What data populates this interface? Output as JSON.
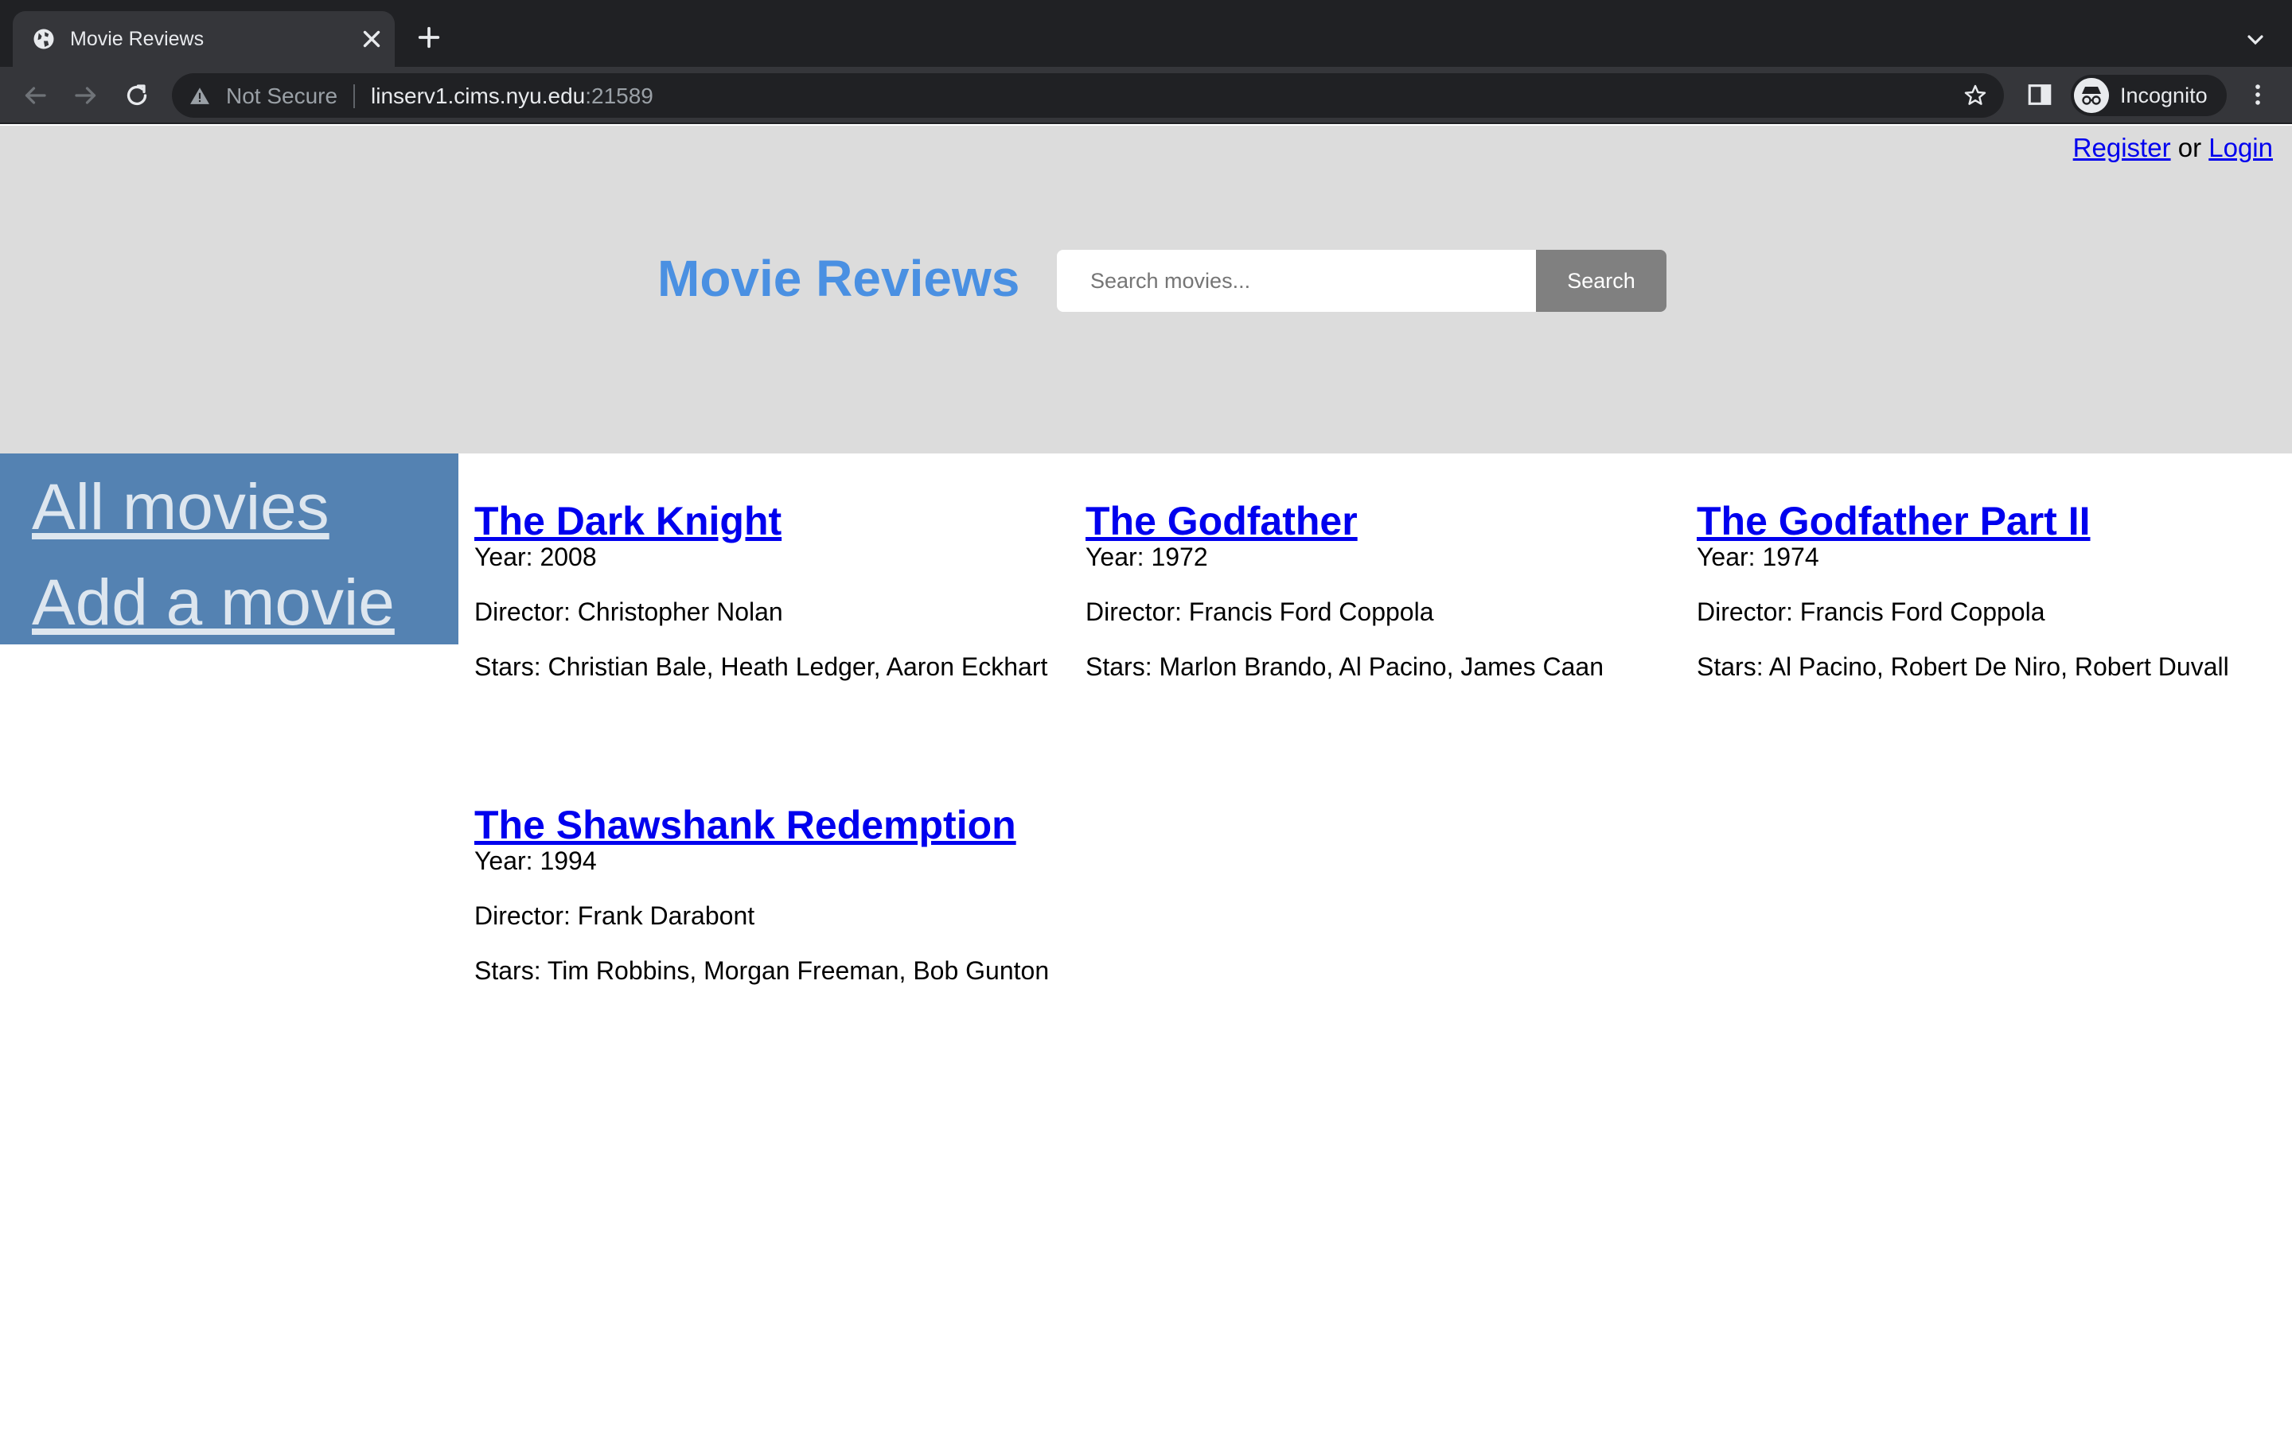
{
  "browser": {
    "tab_title": "Movie Reviews",
    "security_label": "Not Secure",
    "url_host": "linserv1.cims.nyu.edu",
    "url_port": ":21589",
    "profile_label": "Incognito"
  },
  "header": {
    "register_label": "Register",
    "or_text": "or",
    "login_label": "Login",
    "site_title": "Movie Reviews",
    "search_placeholder": "Search movies...",
    "search_button": "Search"
  },
  "sidebar": {
    "items": [
      {
        "label": "All movies"
      },
      {
        "label": "Add a movie"
      }
    ]
  },
  "movies": [
    {
      "title": "The Dark Knight",
      "year": "Year: 2008",
      "director": "Director: Christopher Nolan",
      "stars": "Stars: Christian Bale, Heath Ledger, Aaron Eckhart"
    },
    {
      "title": "The Godfather",
      "year": "Year: 1972",
      "director": "Director: Francis Ford Coppola",
      "stars": "Stars: Marlon Brando, Al Pacino, James Caan"
    },
    {
      "title": "The Godfather Part II",
      "year": "Year: 1974",
      "director": "Director: Francis Ford Coppola",
      "stars": "Stars: Al Pacino, Robert De Niro, Robert Duvall"
    },
    {
      "title": "The Shawshank Redemption",
      "year": "Year: 1994",
      "director": "Director: Frank Darabont",
      "stars": "Stars: Tim Robbins, Morgan Freeman, Bob Gunton"
    }
  ],
  "icons": {
    "tab_favicon": "globe-icon",
    "tab_close": "close-icon",
    "new_tab": "plus-icon",
    "back": "back-arrow-icon",
    "forward": "forward-arrow-icon",
    "reload": "reload-icon",
    "warning": "warning-icon",
    "bookmark": "star-icon",
    "side_panel": "side-panel-icon",
    "incognito": "incognito-icon",
    "menu": "kebab-menu-icon"
  },
  "colors": {
    "site_title": "#4a90e2",
    "sidebar_bg": "#5482b2",
    "header_bg": "#dcdcdc",
    "link": "#0000ee",
    "search_button_bg": "#808080"
  }
}
